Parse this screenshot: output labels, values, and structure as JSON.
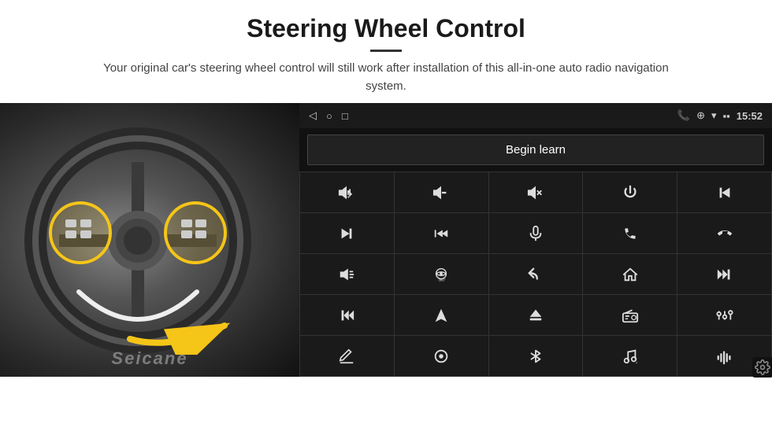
{
  "page": {
    "title": "Steering Wheel Control",
    "divider": true,
    "subtitle": "Your original car's steering wheel control will still work after installation of this all-in-one auto radio navigation system."
  },
  "statusbar": {
    "time": "15:52",
    "icons": [
      "◁",
      "○",
      "□"
    ],
    "right_icons": [
      "📞",
      "⊕",
      "▾",
      "🔋"
    ]
  },
  "begin_learn": {
    "button_label": "Begin learn"
  },
  "controls": [
    {
      "icon": "vol+",
      "unicode": "🔊+",
      "label": "volume up"
    },
    {
      "icon": "vol-",
      "unicode": "🔉−",
      "label": "volume down"
    },
    {
      "icon": "mute",
      "unicode": "🔇",
      "label": "mute"
    },
    {
      "icon": "power",
      "unicode": "⏻",
      "label": "power"
    },
    {
      "icon": "prev-track",
      "unicode": "⏮",
      "label": "prev track"
    },
    {
      "icon": "next",
      "unicode": "⏭",
      "label": "next"
    },
    {
      "icon": "ffwd",
      "unicode": "⏩",
      "label": "fast forward"
    },
    {
      "icon": "mic",
      "unicode": "🎤",
      "label": "microphone"
    },
    {
      "icon": "phone",
      "unicode": "📞",
      "label": "phone"
    },
    {
      "icon": "hang-up",
      "unicode": "📵",
      "label": "hang up"
    },
    {
      "icon": "horn",
      "unicode": "📣",
      "label": "horn"
    },
    {
      "icon": "360",
      "unicode": "360°",
      "label": "360 camera"
    },
    {
      "icon": "back",
      "unicode": "↩",
      "label": "back"
    },
    {
      "icon": "home",
      "unicode": "⌂",
      "label": "home"
    },
    {
      "icon": "rew",
      "unicode": "⏮",
      "label": "rewind"
    },
    {
      "icon": "skip-fwd",
      "unicode": "⏭",
      "label": "skip forward"
    },
    {
      "icon": "nav",
      "unicode": "▲",
      "label": "navigation"
    },
    {
      "icon": "eject",
      "unicode": "⏏",
      "label": "eject"
    },
    {
      "icon": "radio",
      "unicode": "📻",
      "label": "radio"
    },
    {
      "icon": "eq",
      "unicode": "⊞",
      "label": "equalizer"
    },
    {
      "icon": "pen",
      "unicode": "✏",
      "label": "write"
    },
    {
      "icon": "circle-dot",
      "unicode": "◎",
      "label": "settings knob"
    },
    {
      "icon": "bt",
      "unicode": "✻",
      "label": "bluetooth"
    },
    {
      "icon": "music",
      "unicode": "♪",
      "label": "music"
    },
    {
      "icon": "wave",
      "unicode": "≋",
      "label": "sound wave"
    }
  ],
  "watermark": {
    "text": "Seicane"
  },
  "colors": {
    "bg": "#ffffff",
    "screen_bg": "#0a0a0a",
    "statusbar_bg": "#1a1a1a",
    "btn_bg": "#1a1a1a",
    "text_primary": "#ffffff",
    "text_dim": "#cccccc",
    "highlight_yellow": "#f5c518",
    "accent": "#666666"
  }
}
